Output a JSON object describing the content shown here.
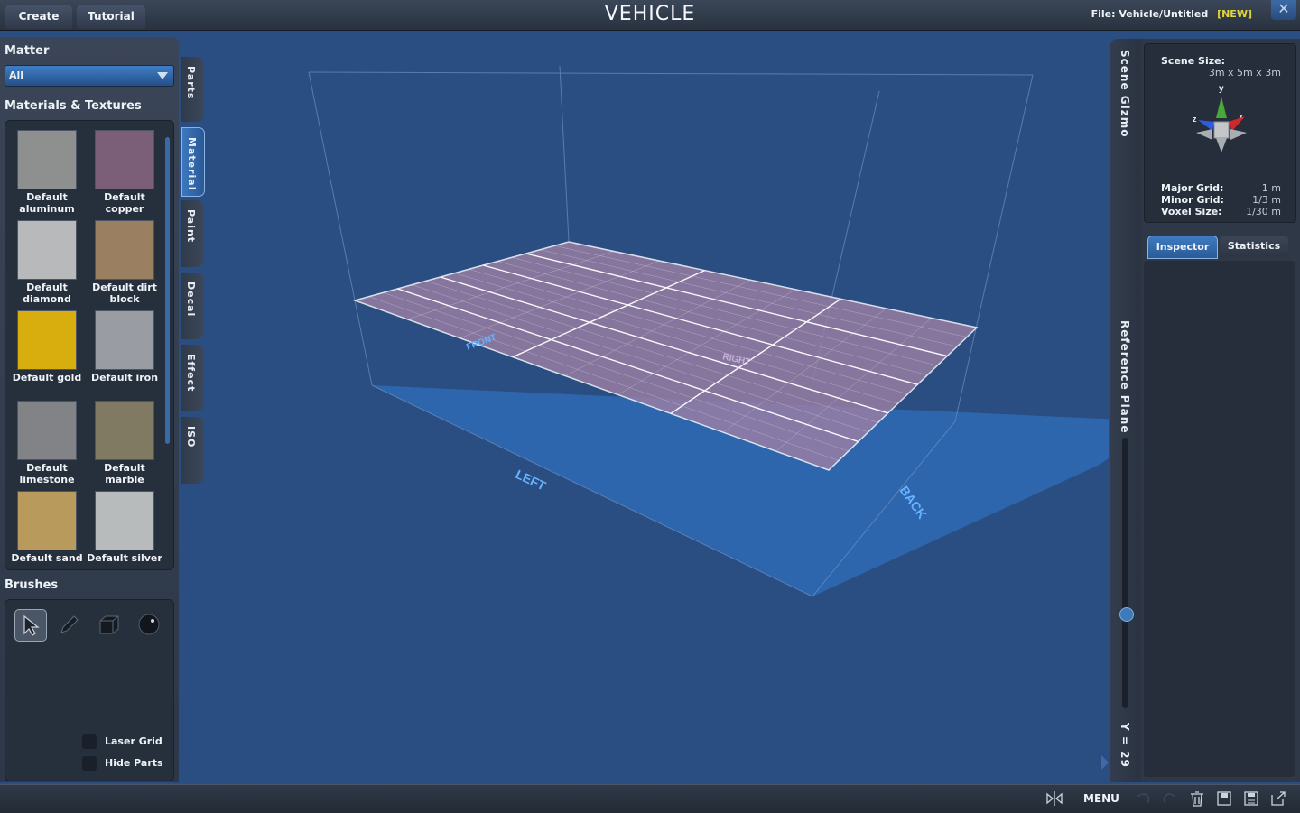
{
  "topbar": {
    "tabs": [
      "Create",
      "Tutorial"
    ],
    "title": "VEHICLE",
    "file_label": "File:",
    "file_path": "Vehicle/Untitled",
    "file_status": "[NEW]",
    "close_symbol": "✕"
  },
  "left_panel": {
    "matter_title": "Matter",
    "matter_selected": "All",
    "materials_title": "Materials & Textures",
    "materials": [
      {
        "label": "Default aluminum",
        "color": "#8e9090"
      },
      {
        "label": "Default copper",
        "color": "#7b5f78"
      },
      {
        "label": "Default diamond",
        "color": "#b7b9bb"
      },
      {
        "label": "Default dirt block",
        "color": "#9a7f60"
      },
      {
        "label": "Default gold",
        "color": "#d8ad0e"
      },
      {
        "label": "Default iron",
        "color": "#9a9ca4"
      },
      {
        "label": "Default limestone",
        "color": "#818386"
      },
      {
        "label": "Default marble",
        "color": "#807a62"
      },
      {
        "label": "Default sand",
        "color": "#b89a5c"
      },
      {
        "label": "Default silver",
        "color": "#b8bbbc"
      }
    ],
    "brushes_title": "Brushes",
    "brushes": [
      "select-arrow-icon",
      "pencil-icon",
      "cube-icon",
      "sphere-icon"
    ],
    "options": [
      "Laser Grid",
      "Hide Parts"
    ]
  },
  "side_tabs": [
    "Parts",
    "Material",
    "Paint",
    "Decal",
    "Effect",
    "ISO"
  ],
  "viewport": {
    "labels": [
      "FRONT",
      "RIGHT",
      "LEFT",
      "BACK"
    ],
    "colors": {
      "floor": "#2e6bb4",
      "plane": "#9b7fa5",
      "grid_line": "#ffffff"
    }
  },
  "right_rail": {
    "gizmo_tab": "Scene Gizmo",
    "plane_tab": "Reference Plane",
    "y_value": "Y = 29",
    "level_fraction": 0.65
  },
  "right_panel": {
    "scene_size_label": "Scene Size:",
    "scene_size_value": "3m x 5m x 3m",
    "axes": [
      "y",
      "z",
      "x"
    ],
    "major_grid_label": "Major Grid:",
    "major_grid_value": "1 m",
    "minor_grid_label": "Minor Grid:",
    "minor_grid_value": "1/3 m",
    "voxel_size_label": "Voxel Size:",
    "voxel_size_value": "1/30 m",
    "tabs": [
      "Inspector",
      "Statistics"
    ]
  },
  "bottombar": {
    "menu_label": "MENU",
    "icons": [
      "mirror-icon",
      "undo-icon",
      "redo-icon",
      "trash-icon",
      "save-icon",
      "save-as-icon",
      "export-icon"
    ]
  }
}
